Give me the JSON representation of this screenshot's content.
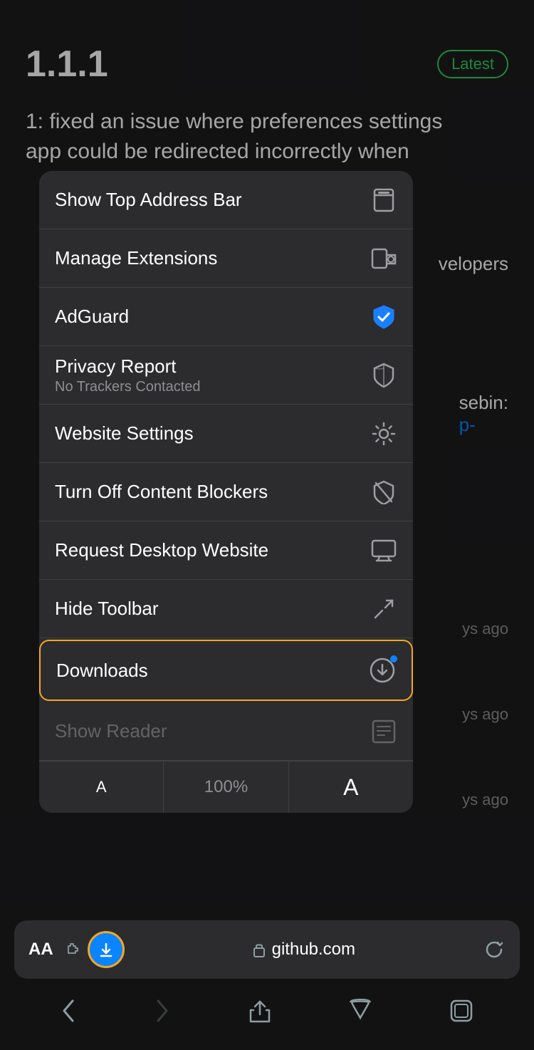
{
  "version": "1.1.1",
  "badge": "Latest",
  "bg_text": "1: fixed an issue where preferences settings app could be redirected incorrectly when",
  "bg_right1": "velopers",
  "bg_sebin": "sebin:",
  "bg_sebin_link": "p-",
  "bg_times": [
    "ys ago",
    "ys ago",
    "ys ago"
  ],
  "menu": {
    "items": [
      {
        "id": "show-top-address-bar",
        "label": "Show Top Address Bar",
        "sublabel": "",
        "icon": "address-bar-icon"
      },
      {
        "id": "manage-extensions",
        "label": "Manage Extensions",
        "sublabel": "",
        "icon": "extensions-icon"
      },
      {
        "id": "adguard",
        "label": "AdGuard",
        "sublabel": "",
        "icon": "adguard-icon"
      },
      {
        "id": "privacy-report",
        "label": "Privacy Report",
        "sublabel": "No Trackers Contacted",
        "icon": "privacy-icon"
      },
      {
        "id": "website-settings",
        "label": "Website Settings",
        "sublabel": "",
        "icon": "settings-icon"
      },
      {
        "id": "turn-off-content-blockers",
        "label": "Turn Off Content Blockers",
        "sublabel": "",
        "icon": "blockers-icon"
      },
      {
        "id": "request-desktop-website",
        "label": "Request Desktop Website",
        "sublabel": "",
        "icon": "desktop-icon"
      },
      {
        "id": "hide-toolbar",
        "label": "Hide Toolbar",
        "sublabel": "",
        "icon": "hide-toolbar-icon"
      },
      {
        "id": "downloads",
        "label": "Downloads",
        "sublabel": "",
        "icon": "download-icon",
        "highlighted": true
      },
      {
        "id": "show-reader",
        "label": "Show Reader",
        "sublabel": "",
        "icon": "reader-icon",
        "dimmed": true
      }
    ],
    "font_row": {
      "small_a": "A",
      "percent": "100%",
      "large_a": "A"
    }
  },
  "toolbar": {
    "aa_label": "AA",
    "url": "github.com",
    "lock_icon": "lock-icon",
    "refresh_icon": "refresh-icon"
  },
  "nav": {
    "back": "‹",
    "forward": "›",
    "share": "share-icon",
    "bookmarks": "bookmarks-icon",
    "tabs": "tabs-icon"
  }
}
